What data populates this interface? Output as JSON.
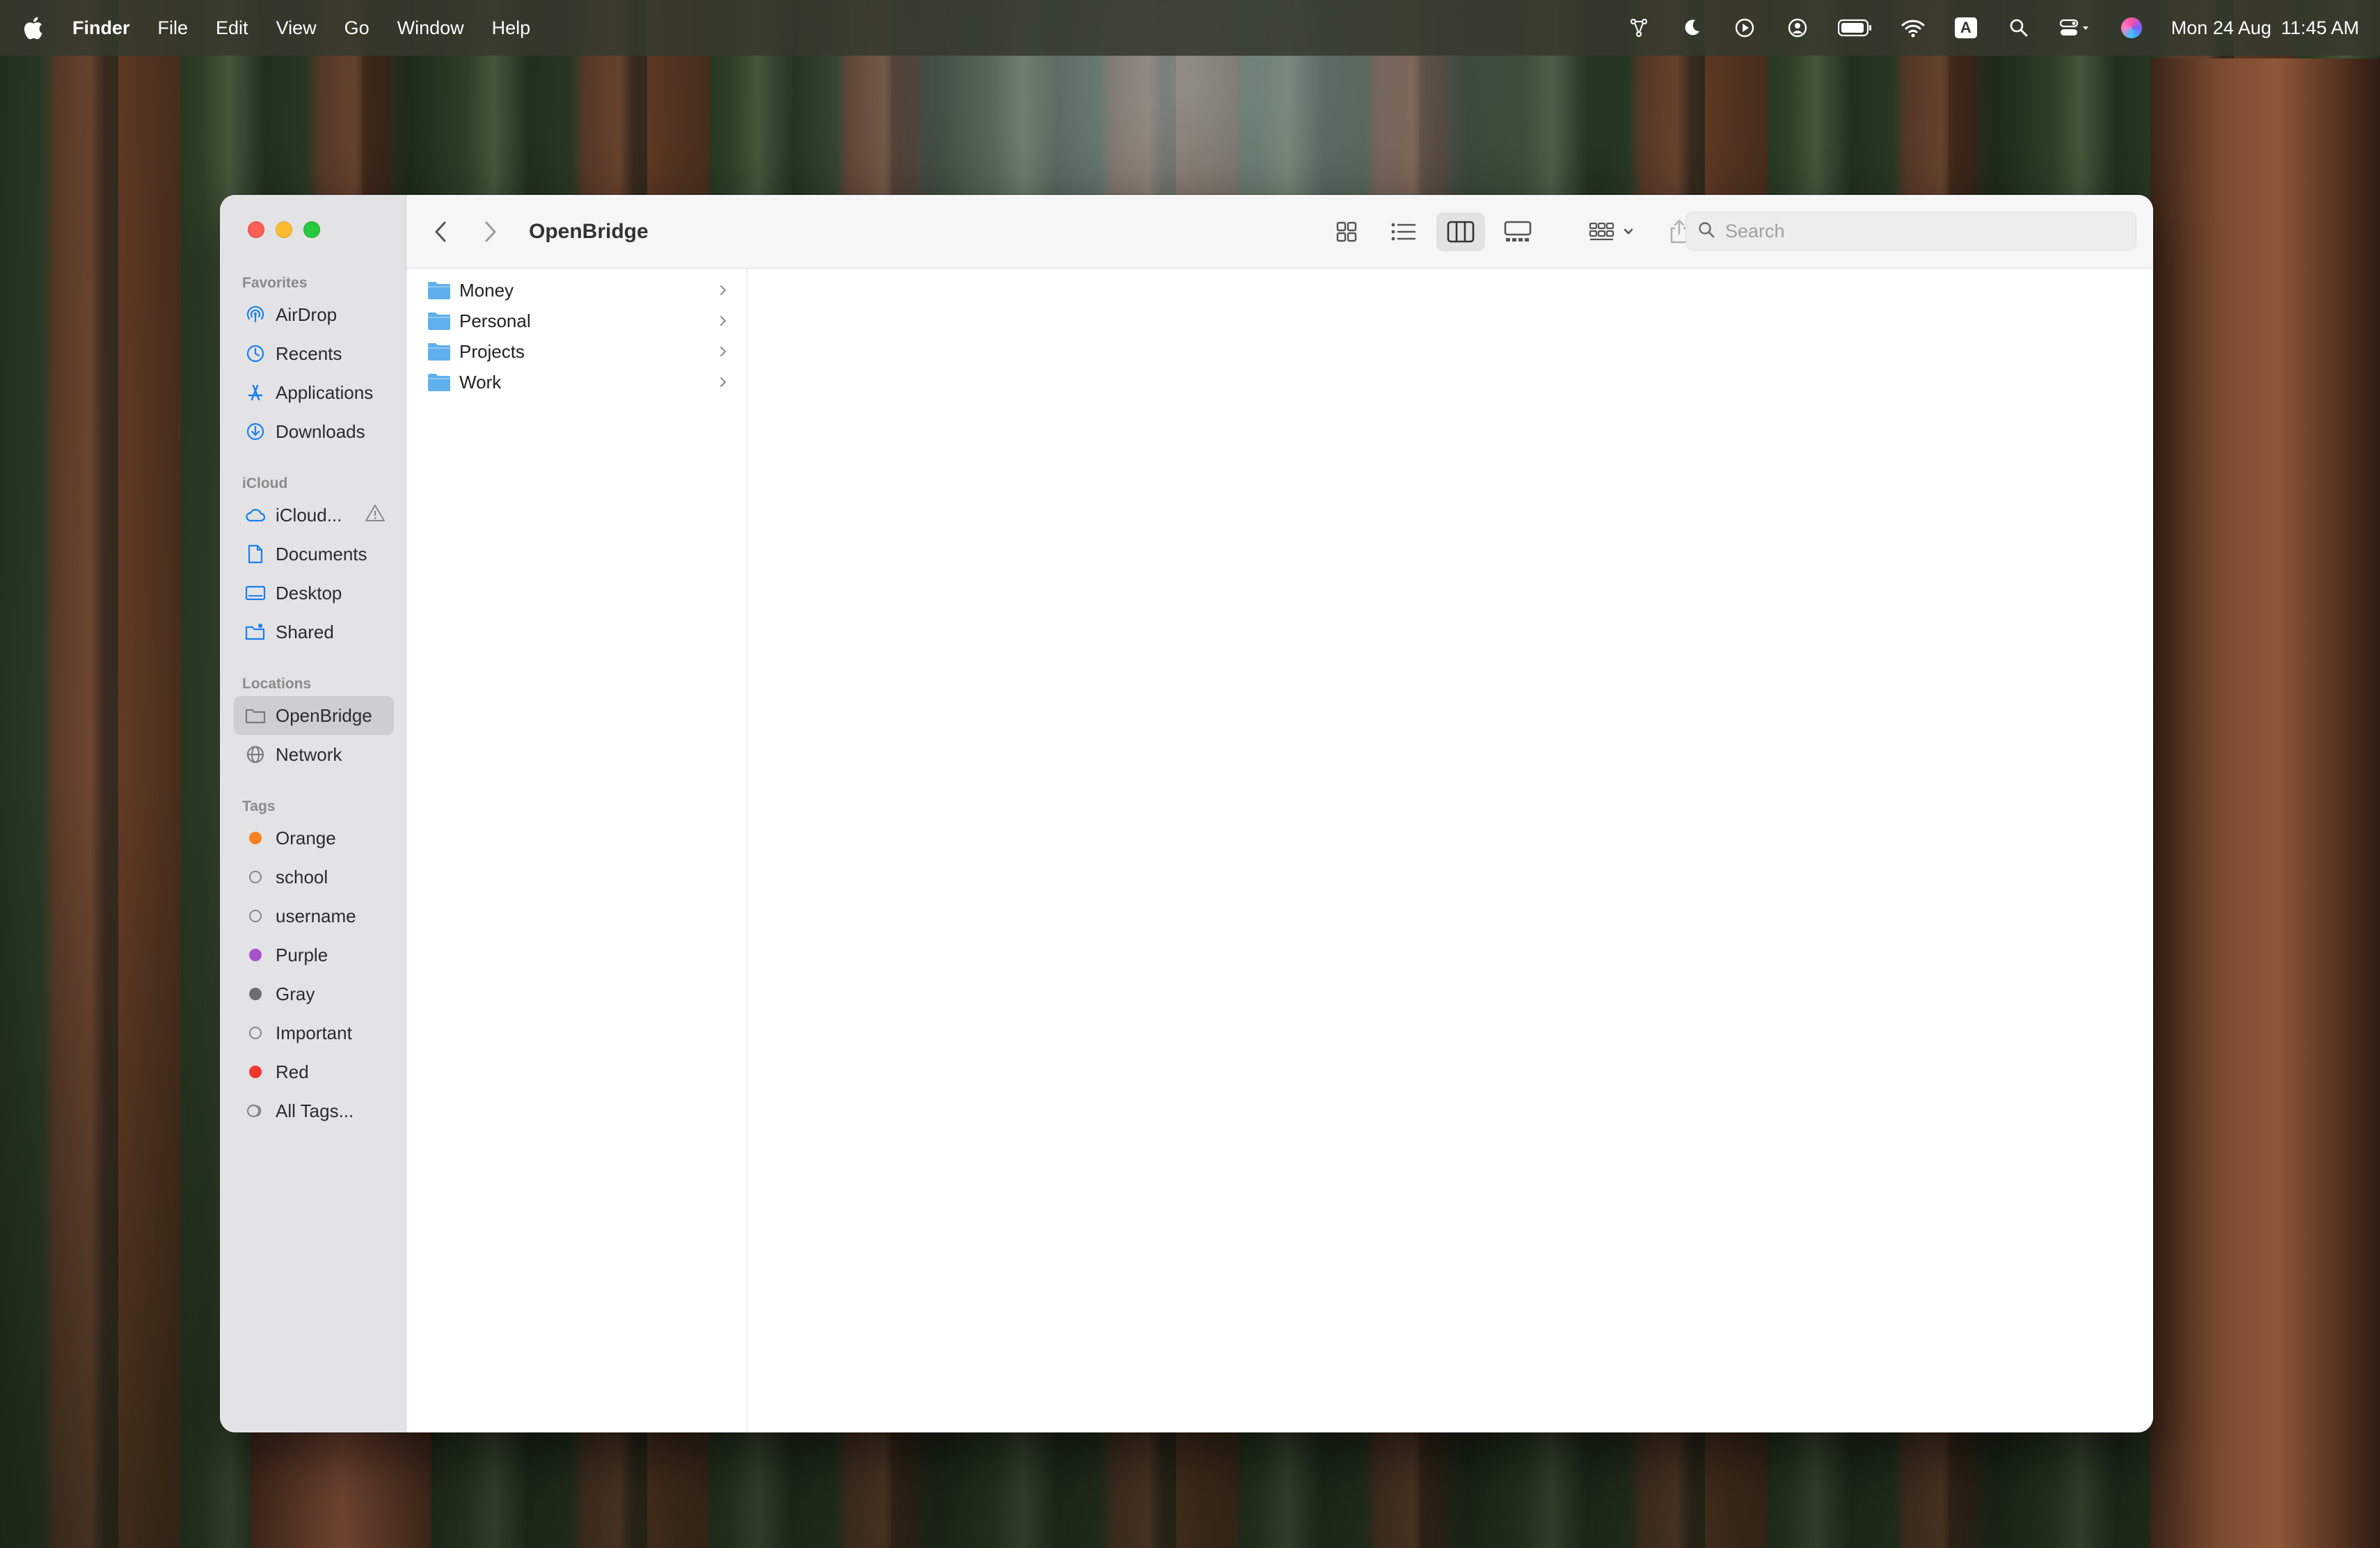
{
  "menubar": {
    "app_name": "Finder",
    "menus": [
      "File",
      "Edit",
      "View",
      "Go",
      "Window",
      "Help"
    ],
    "keyboard_input": "A",
    "date": "Mon 24 Aug",
    "time": "11:45 AM"
  },
  "sidebar": {
    "favorites_heading": "Favorites",
    "favorites": [
      "AirDrop",
      "Recents",
      "Applications",
      "Downloads"
    ],
    "icloud_heading": "iCloud",
    "icloud": [
      "iCloud...",
      "Documents",
      "Desktop",
      "Shared"
    ],
    "locations_heading": "Locations",
    "locations": [
      "OpenBridge",
      "Network"
    ],
    "tags_heading": "Tags",
    "tags": [
      {
        "label": "Orange",
        "color": "#f5821f"
      },
      {
        "label": "school",
        "color": ""
      },
      {
        "label": "username",
        "color": ""
      },
      {
        "label": "Purple",
        "color": "#a551c9"
      },
      {
        "label": "Gray",
        "color": "#6e6e6e"
      },
      {
        "label": "Important",
        "color": ""
      },
      {
        "label": "Red",
        "color": "#f2362c"
      },
      {
        "label": "All Tags...",
        "color": ""
      }
    ]
  },
  "toolbar": {
    "title": "OpenBridge",
    "search_placeholder": "Search",
    "active_view": "columns"
  },
  "columns": {
    "first": [
      "Money",
      "Personal",
      "Projects",
      "Work"
    ]
  },
  "colors": {
    "accent": "#1a7ff0",
    "folder": "#5fb0ec"
  }
}
